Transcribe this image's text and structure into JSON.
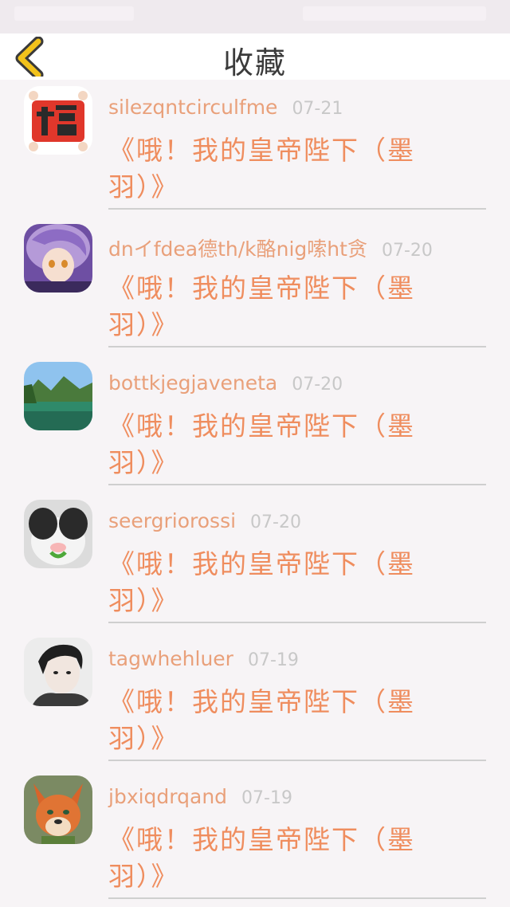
{
  "header": {
    "title": "收藏",
    "back_icon": "chevron-left-icon",
    "accent_color": "#f2c21b"
  },
  "favorites": [
    {
      "user": "silezqntcirculfme",
      "date": "07-21",
      "title": "《哦！我的皇帝陛下（墨羽）》",
      "avatar": "fu-character-avatar"
    },
    {
      "user": "dnイfdea德th/k酪nig嗦ht贪",
      "date": "07-20",
      "title": "《哦！我的皇帝陛下（墨羽）》",
      "avatar": "anime-girl-avatar"
    },
    {
      "user": "bottkjegjaveneta",
      "date": "07-20",
      "title": "《哦！我的皇帝陛下（墨羽）》",
      "avatar": "lake-landscape-avatar"
    },
    {
      "user": "seergriorossi",
      "date": "07-20",
      "title": "《哦！我的皇帝陛下（墨羽）》",
      "avatar": "rabbit-avatar"
    },
    {
      "user": "tagwhehluer",
      "date": "07-19",
      "title": "《哦！我的皇帝陛下（墨羽）》",
      "avatar": "person-portrait-avatar"
    },
    {
      "user": "jbxiqdrqand",
      "date": "07-19",
      "title": "《哦！我的皇帝陛下（墨羽）》",
      "avatar": "fox-avatar"
    }
  ]
}
